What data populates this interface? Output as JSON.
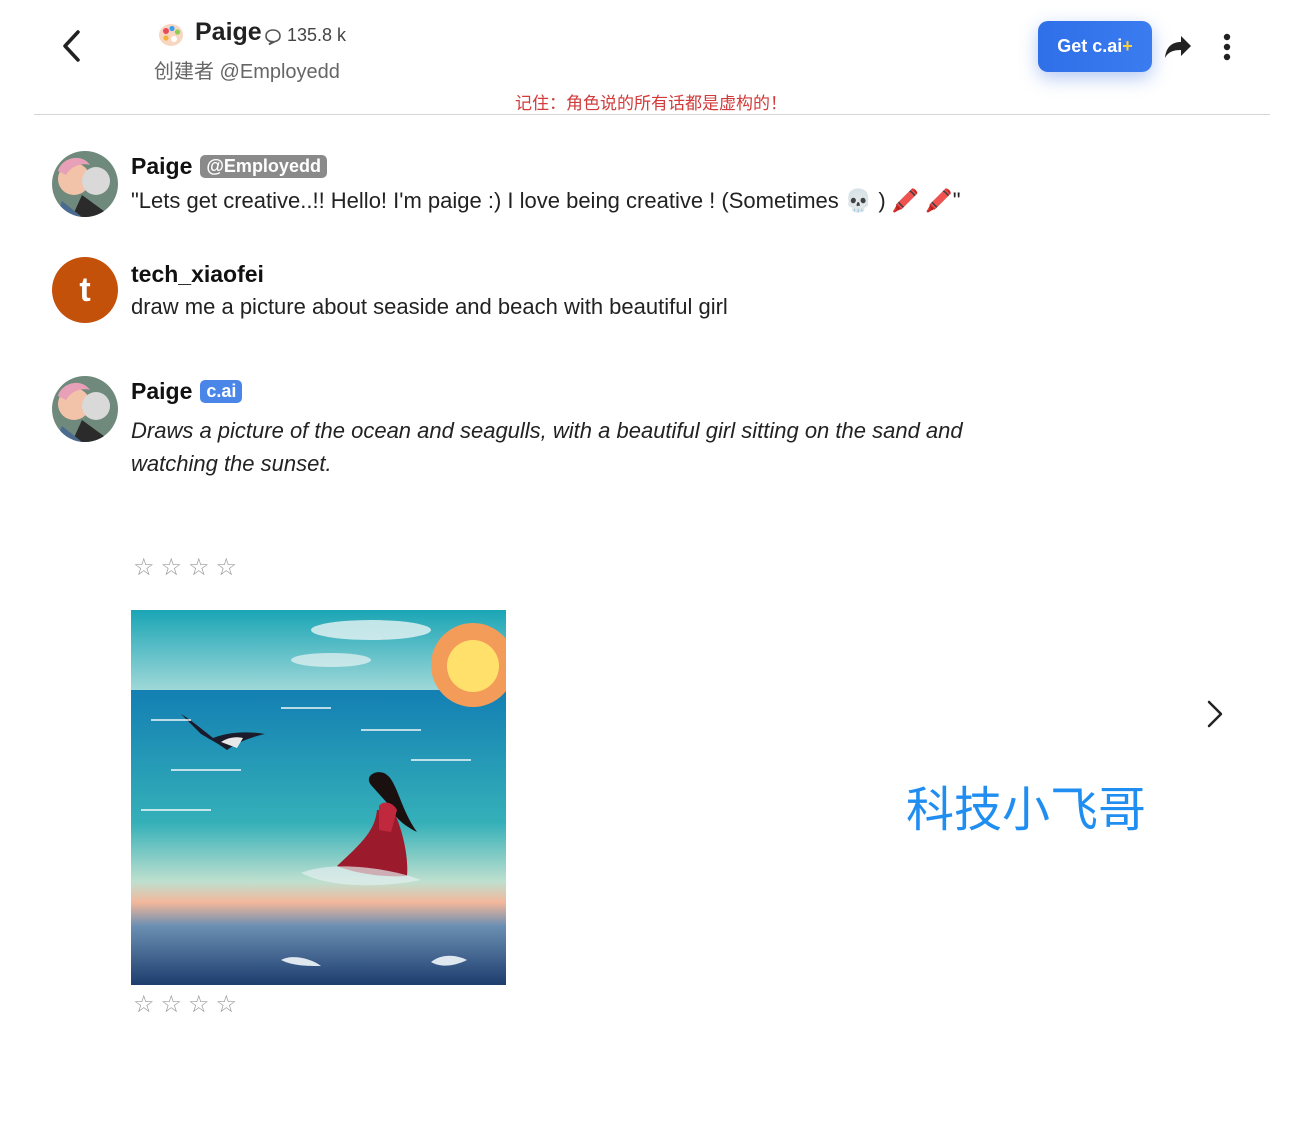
{
  "header": {
    "character_name": "Paige",
    "chat_count": "135.8 k",
    "creator": "创建者 @Employedd",
    "disclaimer": "记住：角色说的所有话都是虚构的！",
    "get_button_main": "Get c.ai",
    "get_button_plus": "+"
  },
  "messages": [
    {
      "sender": "Paige",
      "badge": "@Employedd",
      "text": "\"Lets get creative..!! Hello! I'm paige :) I love being creative ! (Sometimes 💀 ) 🖍️ 🖍️\""
    },
    {
      "sender": "tech_xiaofei",
      "avatar_letter": "t",
      "text": "draw me a picture about seaside and beach with beautiful girl"
    },
    {
      "sender": "Paige",
      "badge": "c.ai",
      "line1": "Draws a picture of the ocean and seagulls, with a beautiful girl sitting on the sand and",
      "line2": "watching the sunset."
    }
  ],
  "rating_stars": "☆☆☆☆",
  "watermark": "科技小飞哥",
  "colors": {
    "accent_blue": "#2f6fe8",
    "disclaimer_red": "#d23b3b",
    "avatar_orange": "#c4510a",
    "watermark_blue": "#1f8ef0"
  }
}
